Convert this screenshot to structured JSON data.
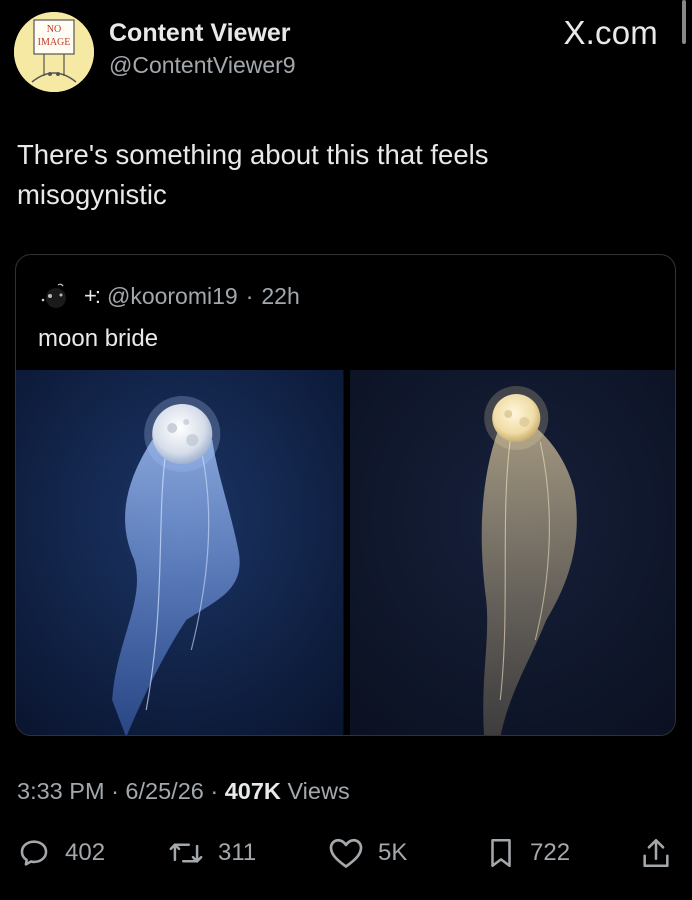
{
  "author": {
    "display_name": "Content Viewer",
    "handle": "@ContentViewer9",
    "avatar_icon": "no-image-placeholder",
    "avatar_text_line1": "NO",
    "avatar_text_line2": "IMAGE"
  },
  "site_label": "X.com",
  "tweet": {
    "text_line1": "There's something about this that feels",
    "text_line2": "misogynistic"
  },
  "quoted": {
    "sparkle_glyphs": "+:",
    "handle": "@kooromi19",
    "separator": "·",
    "time": "22h",
    "text": "moon bride",
    "images": [
      {
        "icon": "moon-veil-blue",
        "tint": "#8fb6ff"
      },
      {
        "icon": "moon-veil-gold",
        "tint": "#f1d9a2"
      }
    ]
  },
  "meta": {
    "time": "3:33 PM",
    "sep1": "·",
    "date": "6/25/26",
    "sep2": "·",
    "views_count": "407K",
    "views_label": "Views"
  },
  "actions": {
    "replies": "402",
    "reposts": "311",
    "likes": "5K",
    "bookmarks": "722"
  },
  "colors": {
    "background": "#000000",
    "text_primary": "#e7e9ea",
    "text_secondary": "#a3a8ad",
    "border": "#2f3336"
  }
}
